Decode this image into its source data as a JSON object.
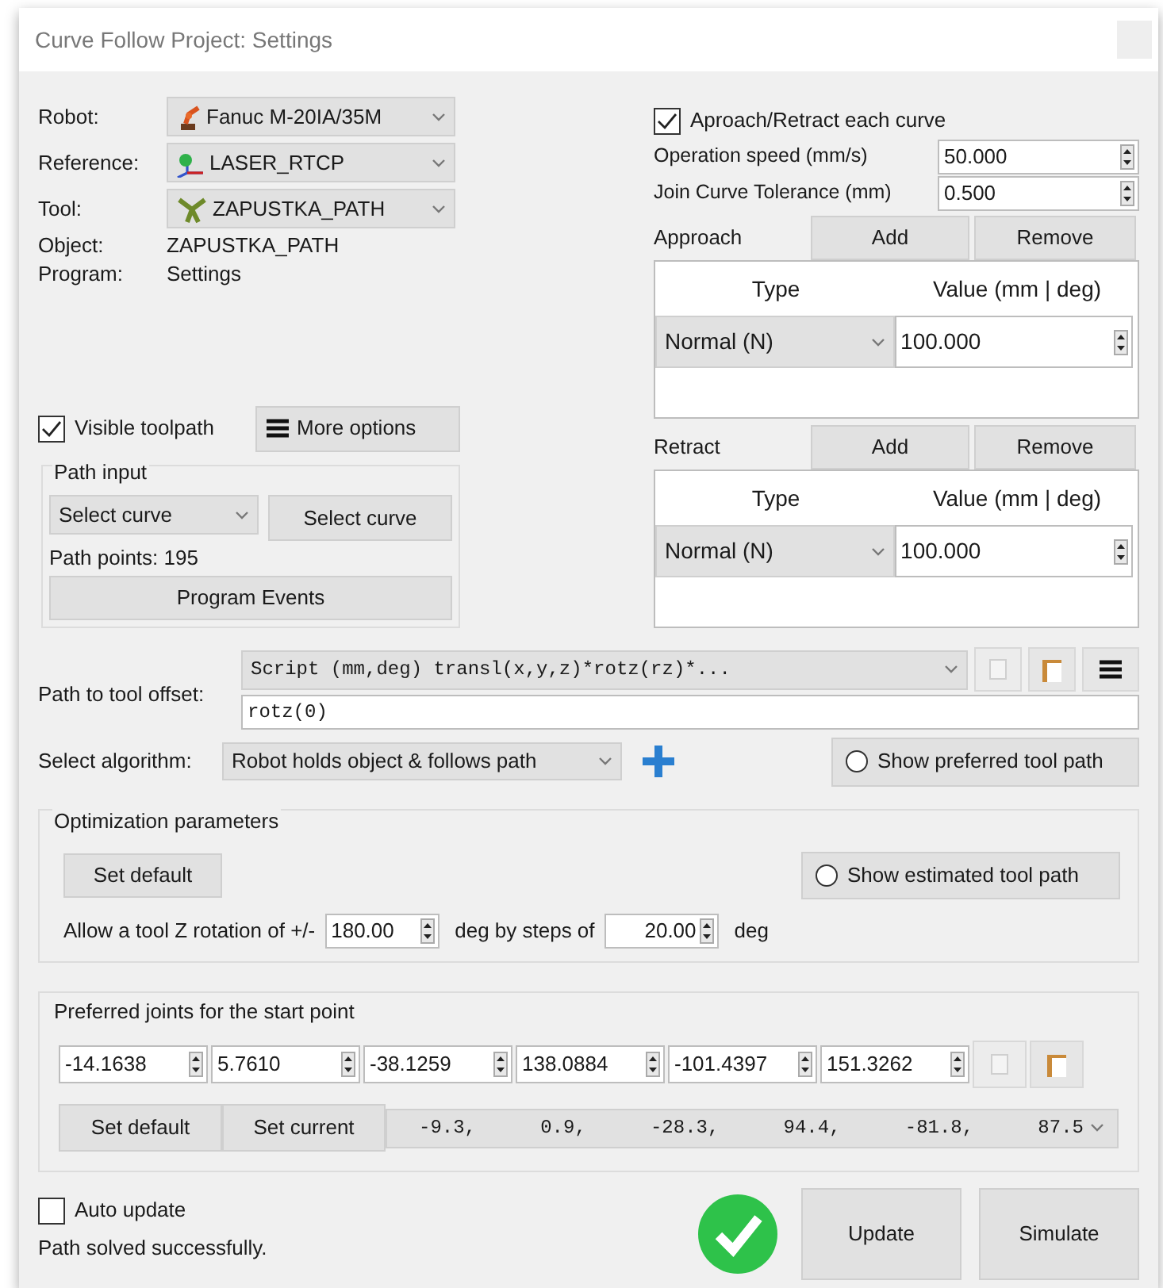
{
  "window": {
    "title": "Curve Follow Project:  Settings"
  },
  "robot_fields": [
    {
      "label": "Robot:",
      "value": "Fanuc M-20IA/35M",
      "kind": "robot"
    },
    {
      "label": "Reference:",
      "value": "LASER_RTCP",
      "kind": "frame"
    },
    {
      "label": "Tool:",
      "value": "ZAPUSTKA_PATH",
      "kind": "tool"
    }
  ],
  "info": [
    {
      "label": "Object:",
      "value": "ZAPUSTKA_PATH"
    },
    {
      "label": "Program:",
      "value": "Settings"
    }
  ],
  "visible_toolpath": {
    "label": "Visible toolpath",
    "checked": true
  },
  "more_options": "More options",
  "path_input": {
    "title": "Path input",
    "select": "Select curve",
    "button": "Select curve",
    "points": "Path points: 195",
    "events_button": "Program Events"
  },
  "approach_retract": {
    "label": "Aproach/Retract each curve",
    "checked": true
  },
  "params": [
    {
      "label": "Operation speed (mm/s)",
      "value": "50.000"
    },
    {
      "label": "Join Curve Tolerance (mm)",
      "value": "0.500"
    }
  ],
  "moves": [
    {
      "title": "Approach",
      "add": "Add",
      "remove": "Remove",
      "columns": [
        "Type",
        "Value (mm | deg)"
      ],
      "rows": [
        {
          "type": "Normal (N)",
          "value": "100.000"
        }
      ]
    },
    {
      "title": "Retract",
      "add": "Add",
      "remove": "Remove",
      "columns": [
        "Type",
        "Value (mm | deg)"
      ],
      "rows": [
        {
          "type": "Normal (N)",
          "value": "100.000"
        }
      ]
    }
  ],
  "offset": {
    "label": "Path to tool offset:",
    "script": "Script (mm,deg) transl(x,y,z)*rotz(rz)*...",
    "value": "rotz(0)"
  },
  "algorithm": {
    "label": "Select algorithm:",
    "value": "Robot holds object & follows path",
    "show_preferred": {
      "label": "Show preferred tool path",
      "checked": false
    }
  },
  "optimization": {
    "title": "Optimization parameters",
    "set_default": "Set default",
    "show_estimated": {
      "label": "Show estimated tool path",
      "checked": false
    },
    "rotation_label": "Allow a tool Z rotation of +/-",
    "rotation": "180.00",
    "steps_label": "deg by steps of",
    "steps": "20.00",
    "unit": "deg"
  },
  "preferred_joints": {
    "title": "Preferred joints for the start point",
    "joints": [
      "-14.1638",
      "5.7610",
      "-38.1259",
      "138.0884",
      "-101.4397",
      "151.3262"
    ],
    "set_default": "Set default",
    "set_current": "Set current",
    "current": [
      "-9.3,",
      "0.9,",
      "-28.3,",
      "94.4,",
      "-81.8,",
      "87.5"
    ]
  },
  "auto_update": {
    "label": "Auto update",
    "checked": false
  },
  "status": "Path solved successfully.",
  "buttons": [
    "Update",
    "Simulate"
  ]
}
